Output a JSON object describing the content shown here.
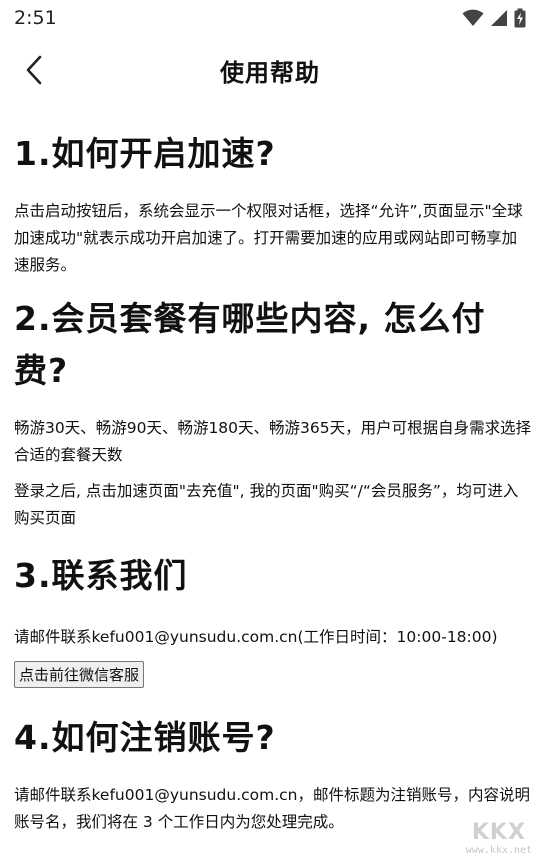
{
  "status_bar": {
    "time": "2:51",
    "icons": [
      "wifi-icon",
      "signal-icon",
      "battery-charging-icon"
    ]
  },
  "header": {
    "back_icon": "chevron-left-icon",
    "title": "使用帮助"
  },
  "faq": [
    {
      "heading": "1.如何开启加速?",
      "paragraphs": [
        "点击启动按钮后，系统会显示一个权限对话框，选择“允许”,页面显示\"全球加速成功\"就表示成功开启加速了。打开需要加速的应用或网站即可畅享加速服务。"
      ]
    },
    {
      "heading": "2.会员套餐有哪些内容, 怎么付费?",
      "paragraphs": [
        "畅游30天、畅游90天、畅游180天、畅游365天，用户可根据自身需求选择合适的套餐天数",
        "登录之后, 点击加速页面\"去充值\", 我的页面\"购买“/“会员服务”，均可进入购买页面"
      ]
    },
    {
      "heading": "3.联系我们",
      "paragraphs": [
        "请邮件联系kefu001@yunsudu.com.cn(工作日时间：10:00-18:00)"
      ],
      "button_label": "点击前往微信客服"
    },
    {
      "heading": "4.如何注销账号?",
      "paragraphs": [
        "请邮件联系kefu001@yunsudu.com.cn，邮件标题为注销账号，内容说明账号名，我们将在 3 个工作日内为您处理完成。"
      ]
    }
  ],
  "watermark": {
    "logo": "KKX",
    "url": "www.kkx.net"
  }
}
